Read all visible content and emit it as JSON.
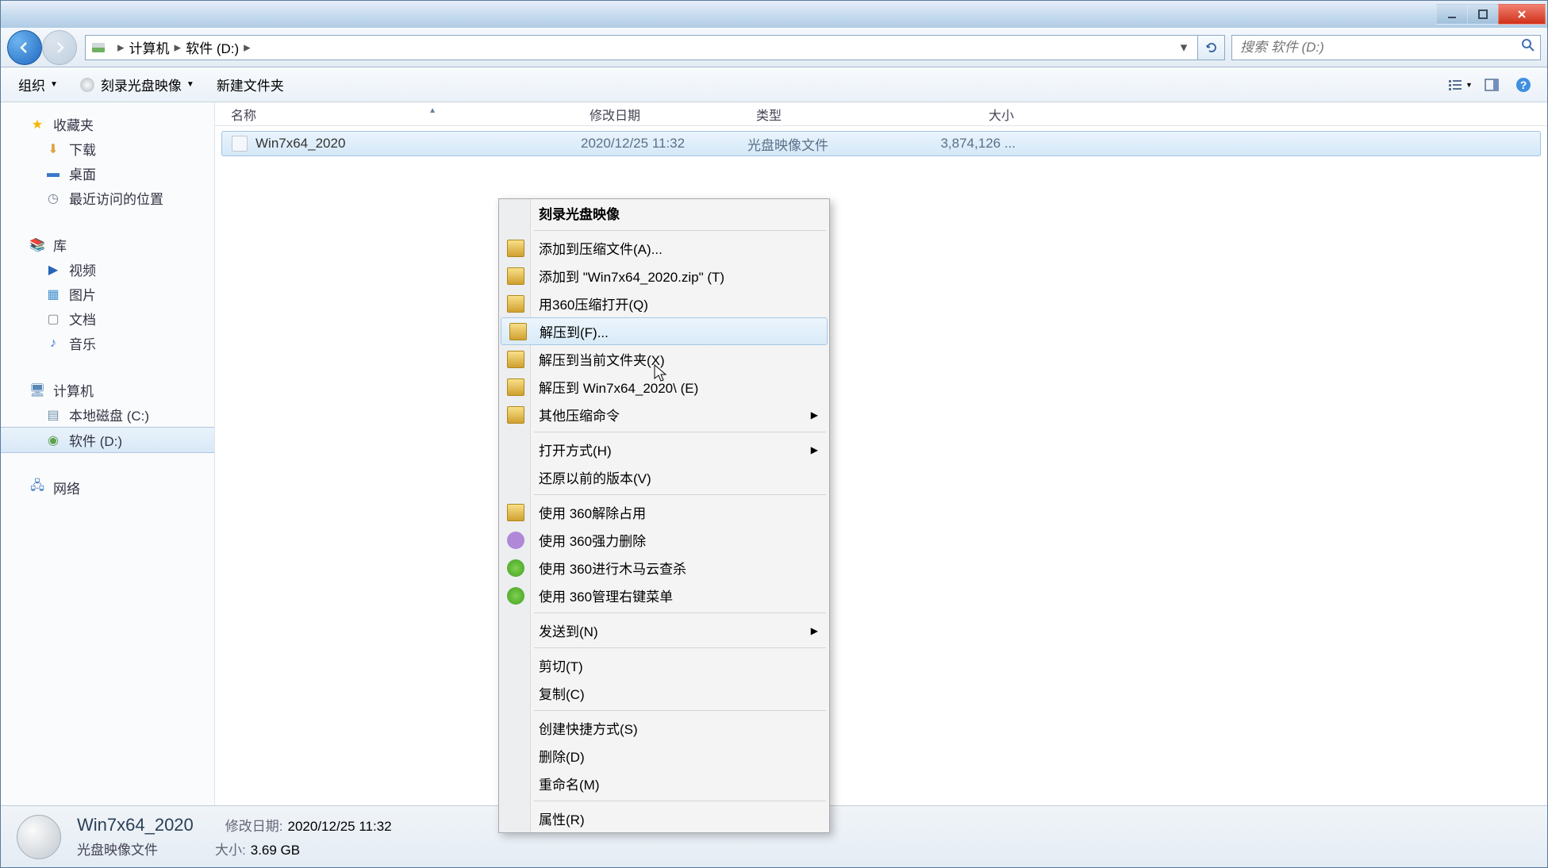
{
  "breadcrumb": {
    "root": "计算机",
    "location": "软件 (D:)"
  },
  "search": {
    "placeholder": "搜索 软件 (D:)"
  },
  "toolbar": {
    "organize": "组织",
    "burn": "刻录光盘映像",
    "newfolder": "新建文件夹"
  },
  "sidebar": {
    "favorites": "收藏夹",
    "downloads": "下载",
    "desktop": "桌面",
    "recent": "最近访问的位置",
    "libraries": "库",
    "videos": "视频",
    "pictures": "图片",
    "documents": "文档",
    "music": "音乐",
    "computer": "计算机",
    "localdisk": "本地磁盘 (C:)",
    "software": "软件 (D:)",
    "network": "网络"
  },
  "columns": {
    "name": "名称",
    "date": "修改日期",
    "type": "类型",
    "size": "大小"
  },
  "file": {
    "name": "Win7x64_2020",
    "date": "2020/12/25 11:32",
    "type": "光盘映像文件",
    "size": "3,874,126 ..."
  },
  "context": {
    "burn": "刻录光盘映像",
    "addArchive": "添加到压缩文件(A)...",
    "addZip": "添加到 \"Win7x64_2020.zip\" (T)",
    "openWith360": "用360压缩打开(Q)",
    "extractTo": "解压到(F)...",
    "extractHere": "解压到当前文件夹(X)",
    "extractFolder": "解压到 Win7x64_2020\\ (E)",
    "otherCompress": "其他压缩命令",
    "openWith": "打开方式(H)",
    "restorePrev": "还原以前的版本(V)",
    "unlock360": "使用 360解除占用",
    "forceDel360": "使用 360强力删除",
    "trojan360": "使用 360进行木马云查杀",
    "manage360": "使用 360管理右键菜单",
    "sendTo": "发送到(N)",
    "cut": "剪切(T)",
    "copy": "复制(C)",
    "shortcut": "创建快捷方式(S)",
    "delete": "删除(D)",
    "rename": "重命名(M)",
    "properties": "属性(R)"
  },
  "details": {
    "name": "Win7x64_2020",
    "type": "光盘映像文件",
    "dateLabel": "修改日期:",
    "date": "2020/12/25 11:32",
    "sizeLabel": "大小:",
    "size": "3.69 GB"
  }
}
